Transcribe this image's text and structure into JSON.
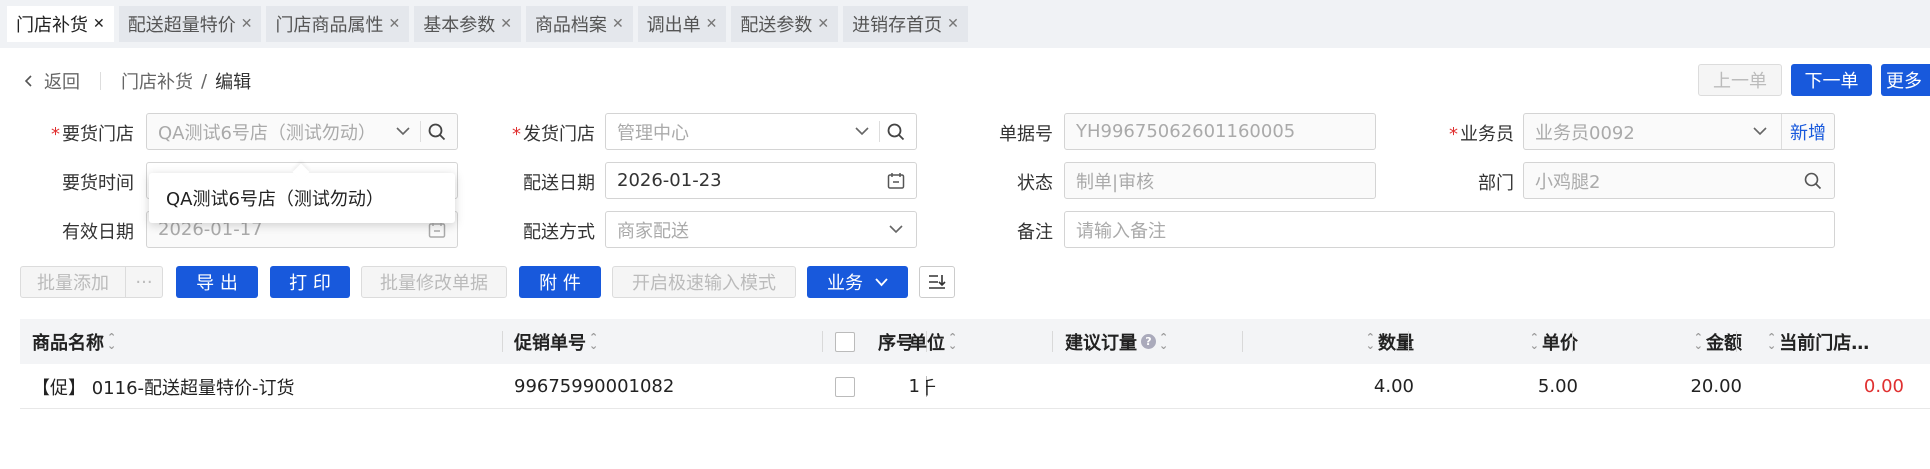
{
  "tabs": [
    {
      "label": "门店补货",
      "active": true
    },
    {
      "label": "配送超量特价"
    },
    {
      "label": "门店商品属性"
    },
    {
      "label": "基本参数"
    },
    {
      "label": "商品档案"
    },
    {
      "label": "调出单"
    },
    {
      "label": "配送参数"
    },
    {
      "label": "进销存首页"
    }
  ],
  "breadcrumb": {
    "back": "返回",
    "parent": "门店补货",
    "sep": "/",
    "current": "编辑"
  },
  "nav": {
    "prev": "上一单",
    "next": "下一单",
    "more": "更多"
  },
  "form": {
    "req_store": {
      "label": "要货门店",
      "value": "QA测试6号店（测试勿动）"
    },
    "ship_store": {
      "label": "发货门店",
      "value": "管理中心"
    },
    "doc_no": {
      "label": "单据号",
      "value": "YH99675062601160005"
    },
    "salesman": {
      "label": "业务员",
      "value": "业务员0092",
      "add": "新增"
    },
    "req_time": {
      "label": "要货时间"
    },
    "delivery_date": {
      "label": "配送日期",
      "value": "2026-01-23"
    },
    "status": {
      "label": "状态",
      "value": "制单|审核"
    },
    "dept": {
      "label": "部门",
      "value": "小鸡腿2"
    },
    "valid_date": {
      "label": "有效日期",
      "value": "2026-01-17"
    },
    "delivery_method": {
      "label": "配送方式",
      "value": "商家配送"
    },
    "remark": {
      "label": "备注",
      "placeholder": "请输入备注"
    }
  },
  "popup": {
    "text": "QA测试6号店（测试勿动）"
  },
  "toolbar": {
    "batch_add": "批量添加",
    "more_dots": "···",
    "export": "导 出",
    "print": "打 印",
    "batch_edit": "批量修改单据",
    "attach": "附 件",
    "fast_input": "开启极速输入模式",
    "business": "业务"
  },
  "table": {
    "headers": {
      "name": "商品名称",
      "promo_no": "促销单号",
      "seq": "序号",
      "unit": "单位",
      "suggest": "建议订量",
      "qty": "数量",
      "price": "单价",
      "amount": "金额",
      "store": "当前门店…"
    },
    "rows": [
      {
        "name": "【促】 0116-配送超量特价-订货",
        "promo_no": "99675990001082",
        "seq": "1",
        "unit": "千",
        "qty": "4.00",
        "price": "5.00",
        "amount": "20.00",
        "store": "0.00"
      }
    ]
  },
  "colors": {
    "primary": "#1859dc",
    "danger": "#e03030"
  }
}
